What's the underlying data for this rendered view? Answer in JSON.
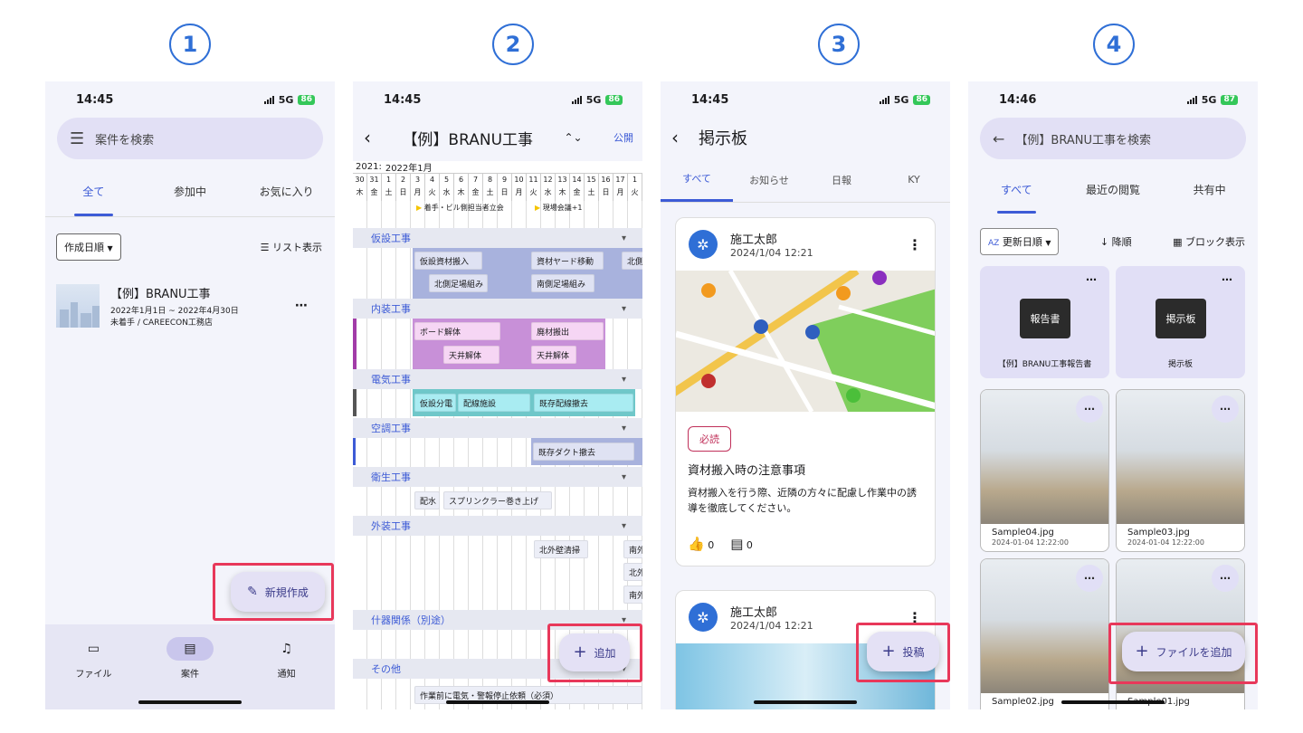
{
  "steps": [
    "1",
    "2",
    "3",
    "4"
  ],
  "phone1": {
    "time": "14:45",
    "network": "5G",
    "battery": "86",
    "search_placeholder": "案件を検索",
    "tabs": [
      "全て",
      "参加中",
      "お気に入り"
    ],
    "sort": "作成日順",
    "view": "リスト表示",
    "project": {
      "title": "【例】BRANU工事",
      "period": "2022年1月1日 ~ 2022年4月30日",
      "meta": "未着手 / CAREECON工務店"
    },
    "fab": "新規作成",
    "nav": [
      "ファイル",
      "案件",
      "通知"
    ]
  },
  "phone2": {
    "time": "14:45",
    "network": "5G",
    "battery": "86",
    "title": "【例】BRANU工事",
    "publish": "公開",
    "year_prev": "2021:",
    "month": "2022年1月",
    "dates": [
      "30",
      "31",
      "1",
      "2",
      "3",
      "4",
      "5",
      "6",
      "7",
      "8",
      "9",
      "10",
      "11",
      "12",
      "13",
      "14",
      "15",
      "16",
      "17",
      "1"
    ],
    "weekdays": [
      "木",
      "金",
      "土",
      "日",
      "月",
      "火",
      "水",
      "木",
      "金",
      "土",
      "日",
      "月",
      "火",
      "水",
      "木",
      "金",
      "土",
      "日",
      "月",
      "火"
    ],
    "milestones": [
      "着手・ビル側担当者立会",
      "現場会議+1"
    ],
    "sections": [
      "仮設工事",
      "内装工事",
      "電気工事",
      "空調工事",
      "衛生工事",
      "外装工事",
      "什器関係（別途）",
      "その他"
    ],
    "tasks": {
      "t1": "仮設資材搬入",
      "t2": "資材ヤード移動",
      "t3": "北側",
      "t4": "北側足場組み",
      "t5": "南側足場組み",
      "t6": "ボード解体",
      "t7": "廃材搬出",
      "t8": "天井解体",
      "t9": "天井解体",
      "t10": "仮設分電",
      "t11": "配線施設",
      "t12": "既存配線撤去",
      "t13": "既存ダクト撤去",
      "t14": "配水",
      "t15": "スプリンクラー巻き上げ",
      "t16": "北外壁清掃",
      "t17": "南外",
      "t18": "北外",
      "t19": "南外",
      "t20": "作業前に電気・警報停止依頼（必須）"
    },
    "fab": "追加"
  },
  "phone3": {
    "time": "14:45",
    "network": "5G",
    "battery": "86",
    "title": "掲示板",
    "tabs": [
      "すべて",
      "お知らせ",
      "日報",
      "KY"
    ],
    "post1": {
      "author": "施工太郎",
      "date": "2024/1/04 12:21",
      "tag": "必読",
      "title": "資材搬入時の注意事項",
      "body": "資材搬入を行う際、近隣の方々に配慮し作業中の誘導を徹底してください。",
      "likes": "0",
      "comments": "0"
    },
    "post2": {
      "author": "施工太郎",
      "date": "2024/1/04 12:21"
    },
    "fab": "投稿"
  },
  "phone4": {
    "time": "14:46",
    "network": "5G",
    "battery": "87",
    "search_placeholder": "【例】BRANU工事を検索",
    "tabs": [
      "すべて",
      "最近の閲覧",
      "共有中"
    ],
    "sort": "更新日順",
    "order": "降順",
    "view": "ブロック表示",
    "folders": [
      {
        "icon": "報告書",
        "name": "【例】BRANU工事報告書"
      },
      {
        "icon": "掲示板",
        "name": "掲示板"
      }
    ],
    "files": [
      {
        "name": "Sample04.jpg",
        "date": "2024-01-04 12:22:00"
      },
      {
        "name": "Sample03.jpg",
        "date": "2024-01-04 12:22:00"
      },
      {
        "name": "Sample02.jpg",
        "date": ""
      },
      {
        "name": "Sample01.jpg",
        "date": ""
      }
    ],
    "fab": "ファイルを追加"
  },
  "colors": {
    "accent": "#3d5bd6",
    "highlight": "#e8385a",
    "fab_bg": "#e4e1f5"
  }
}
